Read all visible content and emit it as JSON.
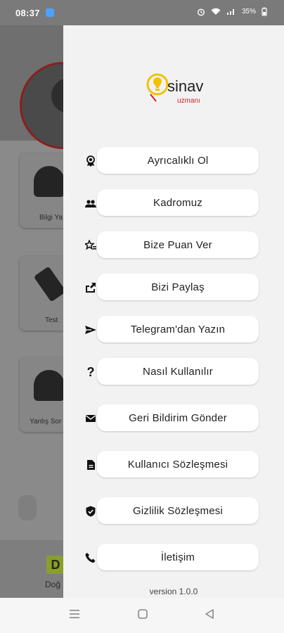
{
  "status_bar": {
    "time": "08:37",
    "battery": "35%",
    "icons": [
      "alarm-icon",
      "wifi-icon",
      "signal-icon",
      "battery-icon"
    ]
  },
  "background_app": {
    "cards": [
      "Bilgi Ya",
      "Test",
      "Yanlış Sor"
    ],
    "bottom_tab": {
      "badge": "D",
      "label": "Doğ"
    }
  },
  "drawer": {
    "logo": {
      "top_text": "sinav",
      "bottom_text": "uzmanı"
    },
    "menu": [
      {
        "label": "Ayrıcalıklı Ol",
        "icon": "medal-icon"
      },
      {
        "label": "Kadromuz",
        "icon": "team-icon"
      },
      {
        "label": "Bize Puan Ver",
        "icon": "star-rate-icon"
      },
      {
        "label": "Bizi Paylaş",
        "icon": "share-icon"
      },
      {
        "label": "Telegram'dan Yazın",
        "icon": "send-icon"
      },
      {
        "label": "Nasıl Kullanılır",
        "icon": "question-icon"
      },
      {
        "label": "Geri Bildirim Gönder",
        "icon": "mail-icon"
      },
      {
        "label": "Kullanıcı Sözleşmesi",
        "icon": "document-icon"
      },
      {
        "label": "Gizlilik Sözleşmesi",
        "icon": "shield-check-icon"
      },
      {
        "label": "İletişim",
        "icon": "phone-icon"
      }
    ],
    "version": "version 1.0.0"
  },
  "colors": {
    "accent_yellow": "#f2c200",
    "accent_red": "#d42020",
    "drawer_bg": "#f2f2f2"
  },
  "nav_bar": {
    "icons": [
      "menu-lines-icon",
      "home-square-icon",
      "back-triangle-icon"
    ]
  }
}
